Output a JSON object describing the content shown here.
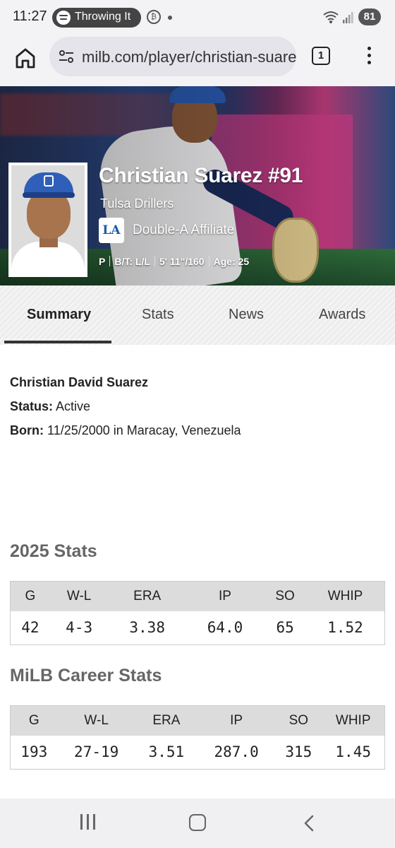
{
  "status_bar": {
    "time": "11:27",
    "media_pill_text": "Throwing It",
    "battery": "81"
  },
  "browser": {
    "url": "milb.com/player/christian-suarez",
    "tab_count": "1"
  },
  "player": {
    "name": "Christian Suarez #91",
    "team": "Tulsa Drillers",
    "affiliate_logo": "LA",
    "affiliate": "Double-A Affiliate",
    "position": "P",
    "bats_throws": "B/T: L/L",
    "height_weight": "5' 11\"/160",
    "age": "Age: 25"
  },
  "tabs": [
    {
      "label": "Summary",
      "active": true
    },
    {
      "label": "Stats",
      "active": false
    },
    {
      "label": "News",
      "active": false
    },
    {
      "label": "Awards",
      "active": false
    }
  ],
  "summary": {
    "full_name": "Christian David Suarez",
    "status_label": "Status:",
    "status_value": "Active",
    "born_label": "Born:",
    "born_value": "11/25/2000 in Maracay, Venezuela"
  },
  "season_stats": {
    "title": "2025 Stats",
    "headers": [
      "G",
      "W-L",
      "ERA",
      "IP",
      "SO",
      "WHIP"
    ],
    "values": [
      "42",
      "4-3",
      "3.38",
      "64.0",
      "65",
      "1.52"
    ]
  },
  "career_stats": {
    "title": "MiLB Career Stats",
    "headers": [
      "G",
      "W-L",
      "ERA",
      "IP",
      "SO",
      "WHIP"
    ],
    "values": [
      "193",
      "27-19",
      "3.51",
      "287.0",
      "315",
      "1.45"
    ]
  },
  "colors": {
    "accent_blue": "#2f5fb8",
    "tab_underline": "#333333",
    "table_header_bg": "#dcdcdc"
  }
}
